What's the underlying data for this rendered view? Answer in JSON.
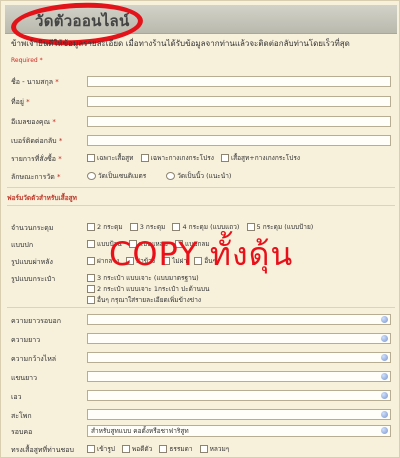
{
  "header": {
    "title": "วัดตัวออนไลน์"
  },
  "intro_text": "ข้าพเจ้ายินดีให้ข้อมูลรายละเอียด เมื่อทางร้านได้รับข้อมูลจากท่านแล้วจะติดต่อกลับท่านโดยเร็วที่สุด",
  "required_label": "Required *",
  "contact_fields": [
    {
      "label": "ชื่อ - นามสกุล",
      "required": "*"
    },
    {
      "label": "ที่อยู่",
      "required": "*"
    },
    {
      "label": "อีเมลของคุณ",
      "required": "*"
    },
    {
      "label": "เบอร์ติดต่อกลับ",
      "required": "*"
    }
  ],
  "order_items": {
    "label": "รายการที่สั่งซื้อ",
    "required": "*",
    "options": [
      "เฉพาะเสื้อสูท",
      "เฉพาะกางเกงกระโปรง",
      "เสื้อสูท+กางเกงกระโปรง"
    ]
  },
  "measure_type": {
    "label": "ลักษณะการวัด",
    "required": "*",
    "options": [
      "วัดเป็นเซนติเมตร",
      "วัดเป็นนิ้ว (แนะนำ)"
    ]
  },
  "section_title": "ฟอร์มวัดตัวสำหรับเสื้อสูท",
  "suit_options": [
    {
      "label": "จำนวนกระดุม",
      "options": [
        "2 กระดุม",
        "3 กระดุม",
        "4 กระดุม (แบบแถว)",
        "5 กระดุม (แบบป้าย)"
      ]
    },
    {
      "label": "แบบปก",
      "options": [
        "แบบป้าน",
        "แบบแหลม",
        "แบบกลม"
      ]
    },
    {
      "label": "รูปแบบผ่าหลัง",
      "options": [
        "ผ่ากลาง",
        "ผ่าข้าง",
        "ไม่ผ่า",
        "อื่นๆ"
      ]
    }
  ],
  "pocket": {
    "label": "รูปแบบกระเป๋า",
    "options": [
      "3 กระเป๋า แบบเจาะ (แบบมาตรฐาน)",
      "2 กระเป๋า แบบเจาะ 1กระเป๋า ปะด้านบน",
      "อื่นๆ กรุณาใส่รายละเอียดเพิ่มข้างข่าง"
    ]
  },
  "measurements": [
    {
      "label": "ความยาวรอบอก"
    },
    {
      "label": "ความยาว"
    },
    {
      "label": "ความกว้างไหล่"
    },
    {
      "label": "แขนยาว"
    },
    {
      "label": "เอว"
    },
    {
      "label": "สะโพก"
    }
  ],
  "collar": {
    "label": "รอบคอ",
    "value": "สำหรับสูทแบบ คอตั้งหรือชาฟาริสูท"
  },
  "shirt_style": {
    "label": "ทรงเสื้อสูทที่ท่านชอบ",
    "options": [
      "เข้ารูป",
      "พอดีตัว",
      "ธรรมดา",
      "หลวมๆ"
    ]
  },
  "watermark": {
    "text": "COPY  ทั้งดุ้น",
    "color": "#e8111a"
  },
  "colors": {
    "accent_red": "#e3131a",
    "section_red": "#c03a2b"
  }
}
